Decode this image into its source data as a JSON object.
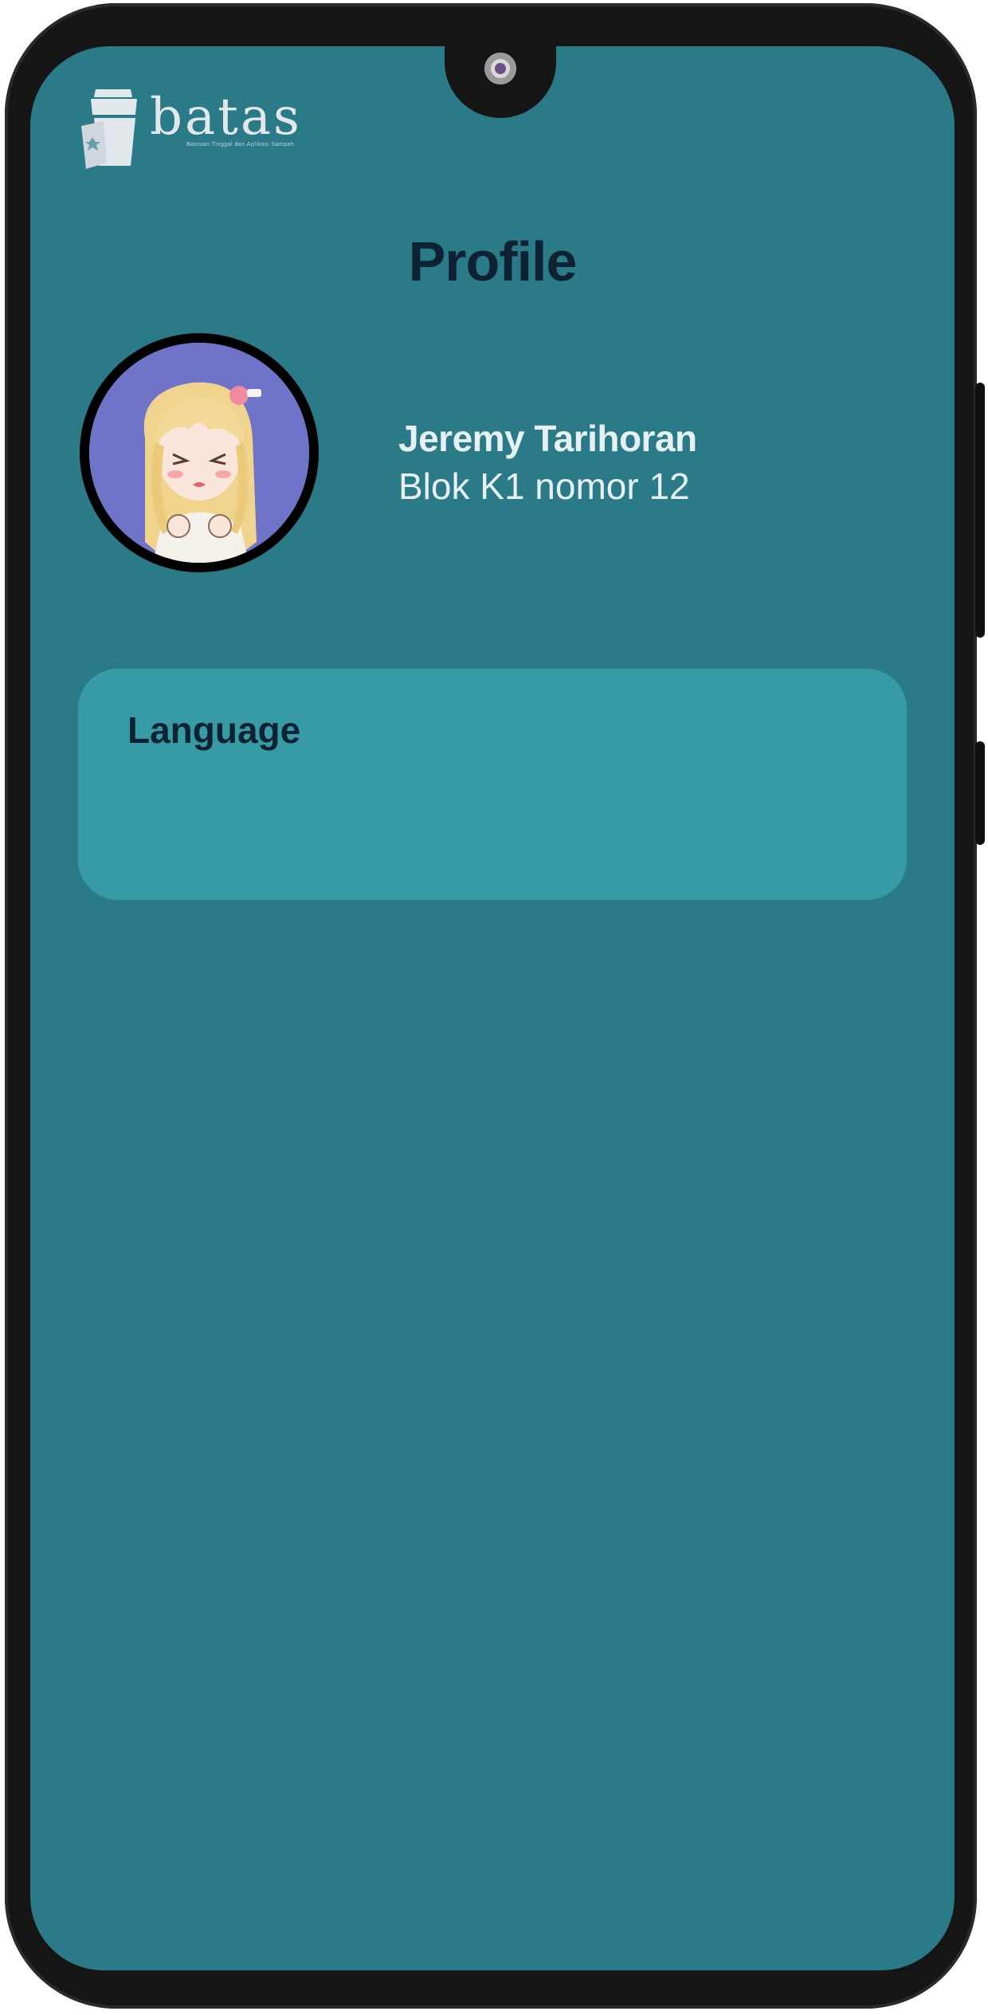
{
  "app": {
    "logo_text": "batas",
    "logo_tagline": "Bantuan Tinggal dan Aplikasi Sampah"
  },
  "header": {
    "title": "Profile"
  },
  "profile": {
    "name": "Jeremy Tarihoran",
    "address": "Blok K1 nomor 12",
    "avatar": "anime-girl-avatar"
  },
  "settings": {
    "language_label": "Language"
  },
  "colors": {
    "screen_bg": "#2a7a87",
    "card_bg": "#369ba4",
    "title_text": "#0e2233",
    "light_text": "#e7f1f4",
    "phone_frame": "#151515"
  }
}
